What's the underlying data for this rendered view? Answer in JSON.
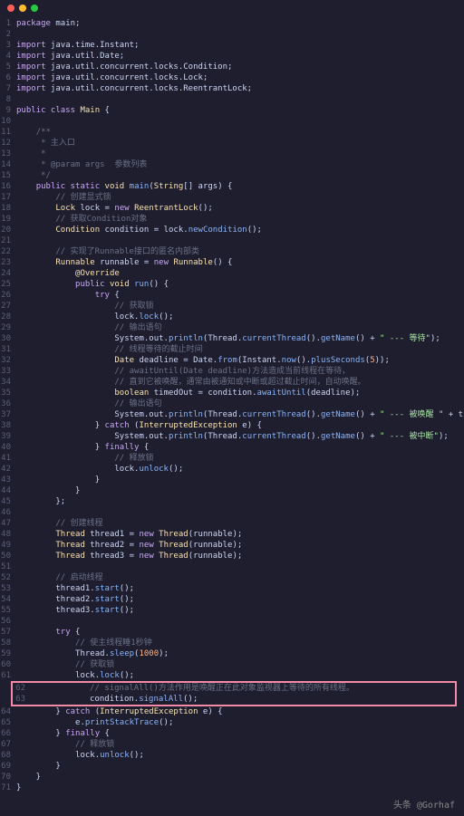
{
  "titlebar": {
    "dots": [
      "red",
      "yellow",
      "green"
    ]
  },
  "lines": [
    {
      "n": 1,
      "t": [
        {
          "c": "kw",
          "s": "package"
        },
        {
          "s": " main;"
        }
      ]
    },
    {
      "n": 2,
      "t": []
    },
    {
      "n": 3,
      "t": [
        {
          "c": "kw",
          "s": "import"
        },
        {
          "s": " java.time.Instant;"
        }
      ]
    },
    {
      "n": 4,
      "t": [
        {
          "c": "kw",
          "s": "import"
        },
        {
          "s": " java.util.Date;"
        }
      ]
    },
    {
      "n": 5,
      "t": [
        {
          "c": "kw",
          "s": "import"
        },
        {
          "s": " java.util.concurrent.locks.Condition;"
        }
      ]
    },
    {
      "n": 6,
      "t": [
        {
          "c": "kw",
          "s": "import"
        },
        {
          "s": " java.util.concurrent.locks.Lock;"
        }
      ]
    },
    {
      "n": 7,
      "t": [
        {
          "c": "kw",
          "s": "import"
        },
        {
          "s": " java.util.concurrent.locks.ReentrantLock;"
        }
      ]
    },
    {
      "n": 8,
      "t": []
    },
    {
      "n": 9,
      "t": [
        {
          "c": "kw",
          "s": "public class "
        },
        {
          "c": "type",
          "s": "Main"
        },
        {
          "s": " {"
        }
      ]
    },
    {
      "n": 10,
      "t": []
    },
    {
      "n": 11,
      "t": [
        {
          "s": "    "
        },
        {
          "c": "cmt",
          "s": "/**"
        }
      ]
    },
    {
      "n": 12,
      "t": [
        {
          "s": "     "
        },
        {
          "c": "cmt",
          "s": "* 主入口"
        }
      ]
    },
    {
      "n": 13,
      "t": [
        {
          "s": "     "
        },
        {
          "c": "cmt",
          "s": "*"
        }
      ]
    },
    {
      "n": 14,
      "t": [
        {
          "s": "     "
        },
        {
          "c": "cmt",
          "s": "* @param args  参数列表"
        }
      ]
    },
    {
      "n": 15,
      "t": [
        {
          "s": "     "
        },
        {
          "c": "cmt",
          "s": "*/"
        }
      ]
    },
    {
      "n": 16,
      "t": [
        {
          "s": "    "
        },
        {
          "c": "kw",
          "s": "public static "
        },
        {
          "c": "type",
          "s": "void"
        },
        {
          "s": " "
        },
        {
          "c": "fn",
          "s": "main"
        },
        {
          "s": "("
        },
        {
          "c": "type",
          "s": "String"
        },
        {
          "s": "[] args) {"
        }
      ]
    },
    {
      "n": 17,
      "t": [
        {
          "s": "        "
        },
        {
          "c": "cmt",
          "s": "// 创建显式锁"
        }
      ]
    },
    {
      "n": 18,
      "t": [
        {
          "s": "        "
        },
        {
          "c": "type",
          "s": "Lock"
        },
        {
          "s": " lock = "
        },
        {
          "c": "kw",
          "s": "new"
        },
        {
          "s": " "
        },
        {
          "c": "type",
          "s": "ReentrantLock"
        },
        {
          "s": "();"
        }
      ]
    },
    {
      "n": 19,
      "t": [
        {
          "s": "        "
        },
        {
          "c": "cmt",
          "s": "// 获取Condition对象"
        }
      ]
    },
    {
      "n": 20,
      "t": [
        {
          "s": "        "
        },
        {
          "c": "type",
          "s": "Condition"
        },
        {
          "s": " condition = lock."
        },
        {
          "c": "fn",
          "s": "newCondition"
        },
        {
          "s": "();"
        }
      ]
    },
    {
      "n": 21,
      "t": []
    },
    {
      "n": 22,
      "t": [
        {
          "s": "        "
        },
        {
          "c": "cmt",
          "s": "// 实现了Runnable接口的匿名内部类"
        }
      ]
    },
    {
      "n": 23,
      "t": [
        {
          "s": "        "
        },
        {
          "c": "type",
          "s": "Runnable"
        },
        {
          "s": " runnable = "
        },
        {
          "c": "kw",
          "s": "new"
        },
        {
          "s": " "
        },
        {
          "c": "type",
          "s": "Runnable"
        },
        {
          "s": "() {"
        }
      ]
    },
    {
      "n": 24,
      "t": [
        {
          "s": "            "
        },
        {
          "c": "ann",
          "s": "@Override"
        }
      ]
    },
    {
      "n": 25,
      "t": [
        {
          "s": "            "
        },
        {
          "c": "kw",
          "s": "public "
        },
        {
          "c": "type",
          "s": "void"
        },
        {
          "s": " "
        },
        {
          "c": "fn",
          "s": "run"
        },
        {
          "s": "() {"
        }
      ]
    },
    {
      "n": 26,
      "t": [
        {
          "s": "                "
        },
        {
          "c": "kw",
          "s": "try"
        },
        {
          "s": " {"
        }
      ]
    },
    {
      "n": 27,
      "t": [
        {
          "s": "                    "
        },
        {
          "c": "cmt",
          "s": "// 获取锁"
        }
      ]
    },
    {
      "n": 28,
      "t": [
        {
          "s": "                    lock."
        },
        {
          "c": "fn",
          "s": "lock"
        },
        {
          "s": "();"
        }
      ]
    },
    {
      "n": 29,
      "t": [
        {
          "s": "                    "
        },
        {
          "c": "cmt",
          "s": "// 输出语句"
        }
      ]
    },
    {
      "n": 30,
      "t": [
        {
          "s": "                    System.out."
        },
        {
          "c": "fn",
          "s": "println"
        },
        {
          "s": "(Thread."
        },
        {
          "c": "fn",
          "s": "currentThread"
        },
        {
          "s": "()."
        },
        {
          "c": "fn",
          "s": "getName"
        },
        {
          "s": "() + "
        },
        {
          "c": "str",
          "s": "\" --- 等待\""
        },
        {
          "s": ");"
        }
      ]
    },
    {
      "n": 31,
      "t": [
        {
          "s": "                    "
        },
        {
          "c": "cmt",
          "s": "// 线程等待的截止时间"
        }
      ]
    },
    {
      "n": 32,
      "t": [
        {
          "s": "                    "
        },
        {
          "c": "type",
          "s": "Date"
        },
        {
          "s": " deadline = Date."
        },
        {
          "c": "fn",
          "s": "from"
        },
        {
          "s": "(Instant."
        },
        {
          "c": "fn",
          "s": "now"
        },
        {
          "s": "()."
        },
        {
          "c": "fn",
          "s": "plusSeconds"
        },
        {
          "s": "("
        },
        {
          "c": "num",
          "s": "5"
        },
        {
          "s": "));"
        }
      ]
    },
    {
      "n": 33,
      "t": [
        {
          "s": "                    "
        },
        {
          "c": "cmt",
          "s": "// awaitUntil(Date deadline)方法造成当前线程在等待，"
        }
      ]
    },
    {
      "n": 34,
      "t": [
        {
          "s": "                    "
        },
        {
          "c": "cmt",
          "s": "// 直到它被唤醒，通常由被通知或中断或超过截止时间，自动唤醒。"
        }
      ]
    },
    {
      "n": 35,
      "t": [
        {
          "s": "                    "
        },
        {
          "c": "type",
          "s": "boolean"
        },
        {
          "s": " timedOut = condition."
        },
        {
          "c": "fn",
          "s": "awaitUntil"
        },
        {
          "s": "(deadline);"
        }
      ]
    },
    {
      "n": 36,
      "t": [
        {
          "s": "                    "
        },
        {
          "c": "cmt",
          "s": "// 输出语句"
        }
      ]
    },
    {
      "n": 37,
      "t": [
        {
          "s": "                    System.out."
        },
        {
          "c": "fn",
          "s": "println"
        },
        {
          "s": "(Thread."
        },
        {
          "c": "fn",
          "s": "currentThread"
        },
        {
          "s": "()."
        },
        {
          "c": "fn",
          "s": "getName"
        },
        {
          "s": "() + "
        },
        {
          "c": "str",
          "s": "\" --- 被唤醒 \""
        },
        {
          "s": " + timedOut);"
        }
      ]
    },
    {
      "n": 38,
      "t": [
        {
          "s": "                } "
        },
        {
          "c": "kw",
          "s": "catch"
        },
        {
          "s": " ("
        },
        {
          "c": "type",
          "s": "InterruptedException"
        },
        {
          "s": " e) {"
        }
      ]
    },
    {
      "n": 39,
      "t": [
        {
          "s": "                    System.out."
        },
        {
          "c": "fn",
          "s": "println"
        },
        {
          "s": "(Thread."
        },
        {
          "c": "fn",
          "s": "currentThread"
        },
        {
          "s": "()."
        },
        {
          "c": "fn",
          "s": "getName"
        },
        {
          "s": "() + "
        },
        {
          "c": "str",
          "s": "\" --- 被中断\""
        },
        {
          "s": ");"
        }
      ]
    },
    {
      "n": 40,
      "t": [
        {
          "s": "                } "
        },
        {
          "c": "kw",
          "s": "finally"
        },
        {
          "s": " {"
        }
      ]
    },
    {
      "n": 41,
      "t": [
        {
          "s": "                    "
        },
        {
          "c": "cmt",
          "s": "// 释放锁"
        }
      ]
    },
    {
      "n": 42,
      "t": [
        {
          "s": "                    lock."
        },
        {
          "c": "fn",
          "s": "unlock"
        },
        {
          "s": "();"
        }
      ]
    },
    {
      "n": 43,
      "t": [
        {
          "s": "                }"
        }
      ]
    },
    {
      "n": 44,
      "t": [
        {
          "s": "            }"
        }
      ]
    },
    {
      "n": 45,
      "t": [
        {
          "s": "        };"
        }
      ]
    },
    {
      "n": 46,
      "t": []
    },
    {
      "n": 47,
      "t": [
        {
          "s": "        "
        },
        {
          "c": "cmt",
          "s": "// 创建线程"
        }
      ]
    },
    {
      "n": 48,
      "t": [
        {
          "s": "        "
        },
        {
          "c": "type",
          "s": "Thread"
        },
        {
          "s": " thread1 = "
        },
        {
          "c": "kw",
          "s": "new"
        },
        {
          "s": " "
        },
        {
          "c": "type",
          "s": "Thread"
        },
        {
          "s": "(runnable);"
        }
      ]
    },
    {
      "n": 49,
      "t": [
        {
          "s": "        "
        },
        {
          "c": "type",
          "s": "Thread"
        },
        {
          "s": " thread2 = "
        },
        {
          "c": "kw",
          "s": "new"
        },
        {
          "s": " "
        },
        {
          "c": "type",
          "s": "Thread"
        },
        {
          "s": "(runnable);"
        }
      ]
    },
    {
      "n": 50,
      "t": [
        {
          "s": "        "
        },
        {
          "c": "type",
          "s": "Thread"
        },
        {
          "s": " thread3 = "
        },
        {
          "c": "kw",
          "s": "new"
        },
        {
          "s": " "
        },
        {
          "c": "type",
          "s": "Thread"
        },
        {
          "s": "(runnable);"
        }
      ]
    },
    {
      "n": 51,
      "t": []
    },
    {
      "n": 52,
      "t": [
        {
          "s": "        "
        },
        {
          "c": "cmt",
          "s": "// 启动线程"
        }
      ]
    },
    {
      "n": 53,
      "t": [
        {
          "s": "        thread1."
        },
        {
          "c": "fn",
          "s": "start"
        },
        {
          "s": "();"
        }
      ]
    },
    {
      "n": 54,
      "t": [
        {
          "s": "        thread2."
        },
        {
          "c": "fn",
          "s": "start"
        },
        {
          "s": "();"
        }
      ]
    },
    {
      "n": 55,
      "t": [
        {
          "s": "        thread3."
        },
        {
          "c": "fn",
          "s": "start"
        },
        {
          "s": "();"
        }
      ]
    },
    {
      "n": 56,
      "t": []
    },
    {
      "n": 57,
      "t": [
        {
          "s": "        "
        },
        {
          "c": "kw",
          "s": "try"
        },
        {
          "s": " {"
        }
      ]
    },
    {
      "n": 58,
      "t": [
        {
          "s": "            "
        },
        {
          "c": "cmt",
          "s": "// 使主线程睡1秒钟"
        }
      ]
    },
    {
      "n": 59,
      "t": [
        {
          "s": "            Thread."
        },
        {
          "c": "fn",
          "s": "sleep"
        },
        {
          "s": "("
        },
        {
          "c": "num",
          "s": "1000"
        },
        {
          "s": ");"
        }
      ]
    },
    {
      "n": 60,
      "t": [
        {
          "s": "            "
        },
        {
          "c": "cmt",
          "s": "// 获取锁"
        }
      ]
    },
    {
      "n": 61,
      "t": [
        {
          "s": "            lock."
        },
        {
          "c": "fn",
          "s": "lock"
        },
        {
          "s": "();"
        }
      ]
    },
    {
      "n": 62,
      "t": [
        {
          "s": "            "
        },
        {
          "c": "cmt",
          "s": "// signalAll()方法作用是唤醒正在此对象监视器上等待的所有线程。"
        }
      ],
      "hl": true
    },
    {
      "n": 63,
      "t": [
        {
          "s": "            condition."
        },
        {
          "c": "fn",
          "s": "signalAll"
        },
        {
          "s": "();"
        }
      ],
      "hl": true
    },
    {
      "n": 64,
      "t": [
        {
          "s": "        } "
        },
        {
          "c": "kw",
          "s": "catch"
        },
        {
          "s": " ("
        },
        {
          "c": "type",
          "s": "InterruptedException"
        },
        {
          "s": " e) {"
        }
      ]
    },
    {
      "n": 65,
      "t": [
        {
          "s": "            e."
        },
        {
          "c": "fn",
          "s": "printStackTrace"
        },
        {
          "s": "();"
        }
      ]
    },
    {
      "n": 66,
      "t": [
        {
          "s": "        } "
        },
        {
          "c": "kw",
          "s": "finally"
        },
        {
          "s": " {"
        }
      ]
    },
    {
      "n": 67,
      "t": [
        {
          "s": "            "
        },
        {
          "c": "cmt",
          "s": "// 释放锁"
        }
      ]
    },
    {
      "n": 68,
      "t": [
        {
          "s": "            lock."
        },
        {
          "c": "fn",
          "s": "unlock"
        },
        {
          "s": "();"
        }
      ]
    },
    {
      "n": 69,
      "t": [
        {
          "s": "        }"
        }
      ]
    },
    {
      "n": 70,
      "t": [
        {
          "s": "    }"
        }
      ]
    },
    {
      "n": 71,
      "t": [
        {
          "s": "}"
        }
      ]
    }
  ],
  "footer": "头条 @Gorhaf"
}
